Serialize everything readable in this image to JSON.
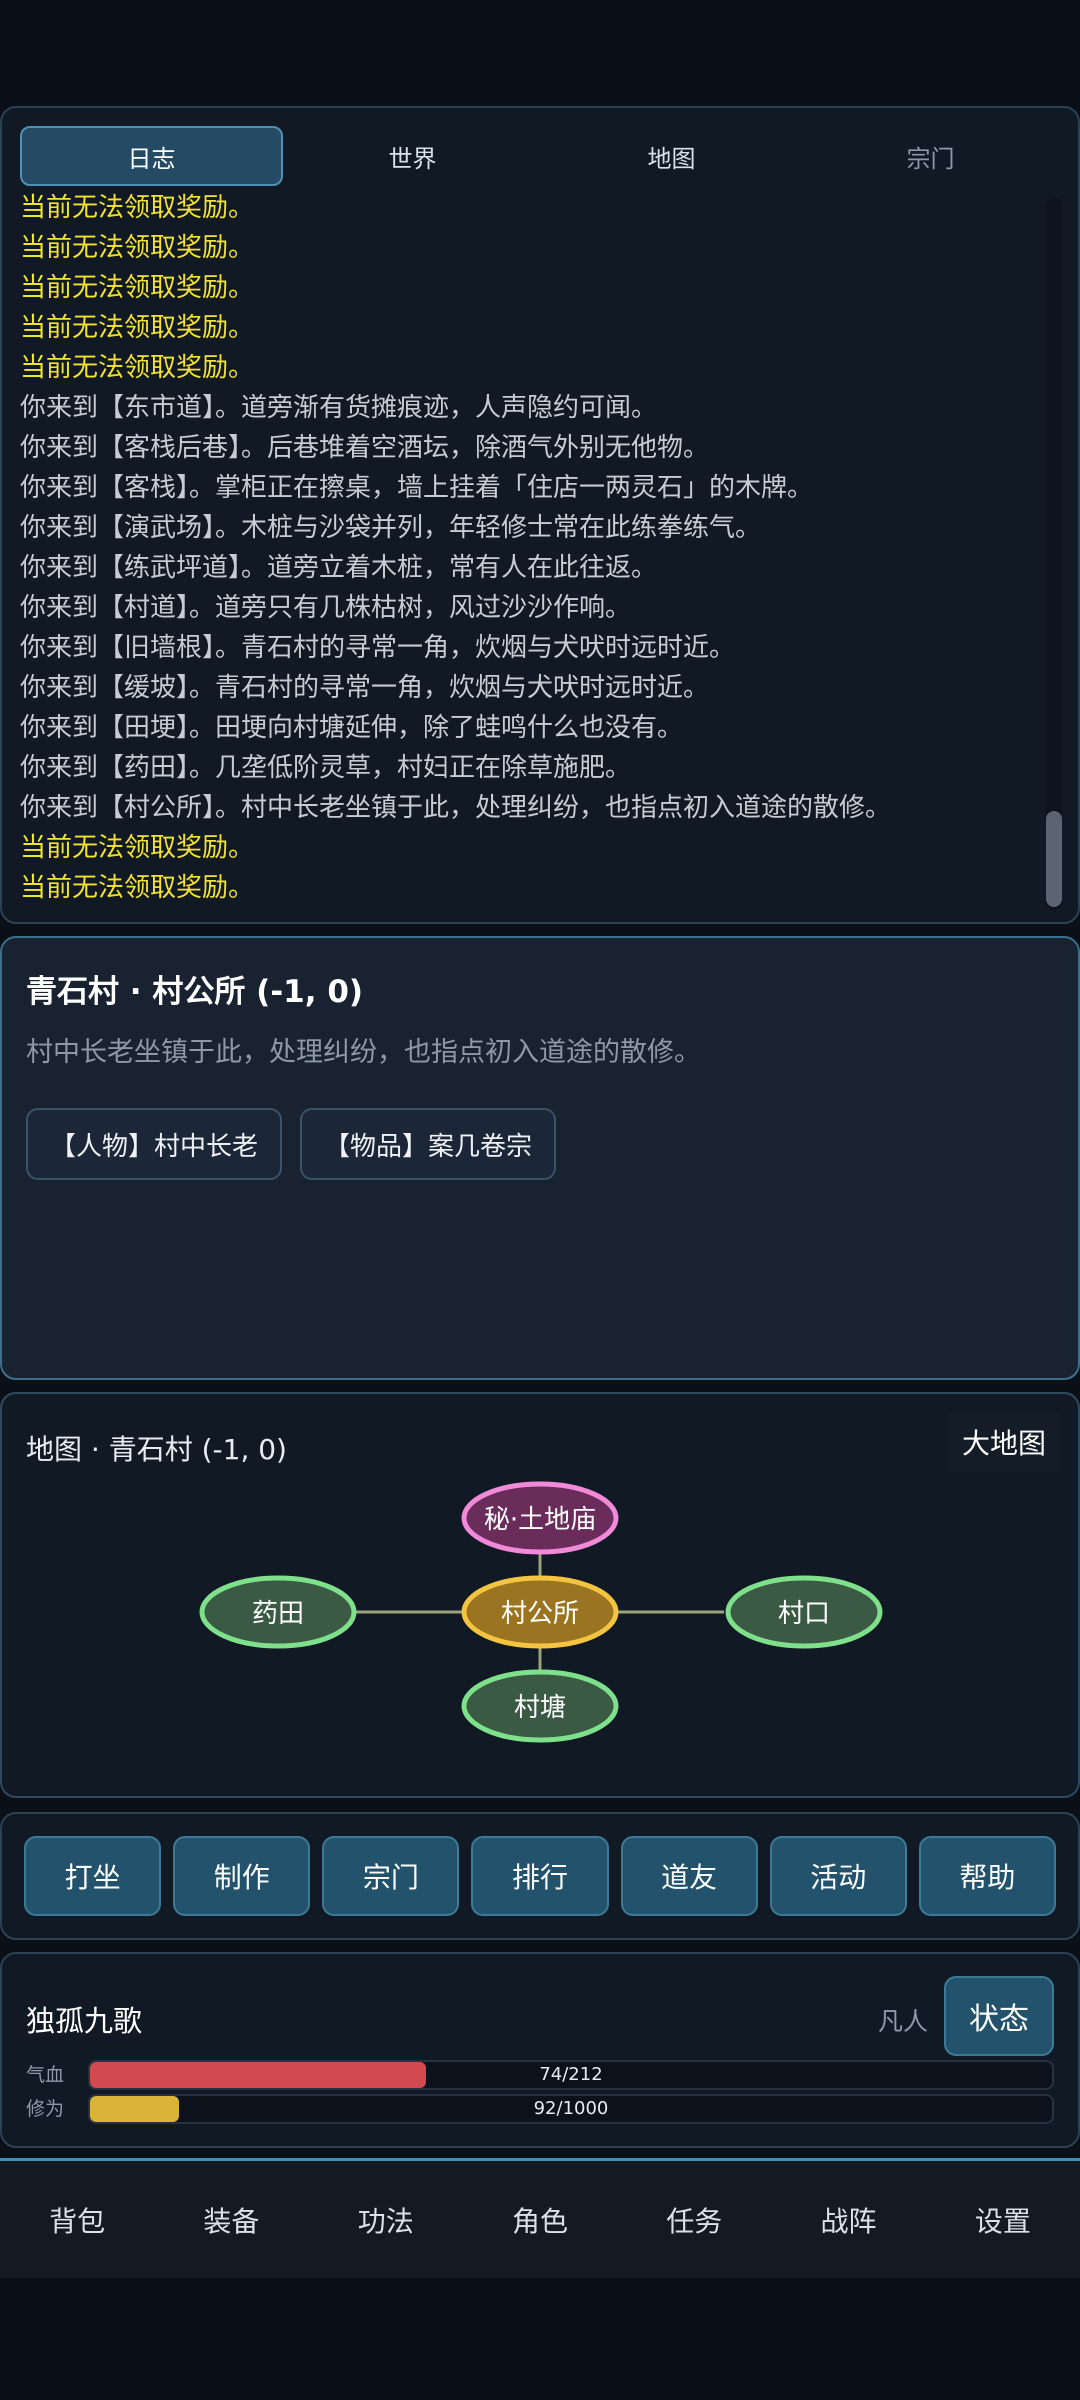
{
  "log": {
    "tabs": [
      {
        "label": "日志"
      },
      {
        "label": "世界"
      },
      {
        "label": "地图"
      },
      {
        "label": "宗门"
      }
    ],
    "lines": [
      {
        "text": "当前无法领取奖励。",
        "kind": "warn"
      },
      {
        "text": "当前无法领取奖励。",
        "kind": "warn"
      },
      {
        "text": "当前无法领取奖励。",
        "kind": "warn"
      },
      {
        "text": "当前无法领取奖励。",
        "kind": "warn"
      },
      {
        "text": "当前无法领取奖励。",
        "kind": "warn"
      },
      {
        "text": "你来到【东市道】。道旁渐有货摊痕迹，人声隐约可闻。",
        "kind": "info"
      },
      {
        "text": "你来到【客栈后巷】。后巷堆着空酒坛，除酒气外别无他物。",
        "kind": "info"
      },
      {
        "text": "你来到【客栈】。掌柜正在擦桌，墙上挂着「住店一两灵石」的木牌。",
        "kind": "info"
      },
      {
        "text": "你来到【演武场】。木桩与沙袋并列，年轻修士常在此练拳练气。",
        "kind": "info"
      },
      {
        "text": "你来到【练武坪道】。道旁立着木桩，常有人在此往返。",
        "kind": "info"
      },
      {
        "text": "你来到【村道】。道旁只有几株枯树，风过沙沙作响。",
        "kind": "info"
      },
      {
        "text": "你来到【旧墙根】。青石村的寻常一角，炊烟与犬吠时远时近。",
        "kind": "info"
      },
      {
        "text": "你来到【缓坡】。青石村的寻常一角，炊烟与犬吠时远时近。",
        "kind": "info"
      },
      {
        "text": "你来到【田埂】。田埂向村塘延伸，除了蛙鸣什么也没有。",
        "kind": "info"
      },
      {
        "text": "你来到【药田】。几垄低阶灵草，村妇正在除草施肥。",
        "kind": "info"
      },
      {
        "text": "你来到【村公所】。村中长老坐镇于此，处理纠纷，也指点初入道途的散修。",
        "kind": "info"
      },
      {
        "text": "当前无法领取奖励。",
        "kind": "warn"
      },
      {
        "text": "当前无法领取奖励。",
        "kind": "warn"
      }
    ]
  },
  "location": {
    "title": "青石村 · 村公所 (-1, 0)",
    "description": "村中长老坐镇于此，处理纠纷，也指点初入道途的散修。",
    "chips": [
      {
        "label": "【人物】村中长老"
      },
      {
        "label": "【物品】案几卷宗"
      }
    ]
  },
  "map": {
    "title": "地图 · 青石村 (-1, 0)",
    "big_map_label": "大地图",
    "nodes": [
      {
        "label": "秘·土地庙",
        "kind": "secret"
      },
      {
        "label": "药田",
        "kind": "normal"
      },
      {
        "label": "村公所",
        "kind": "current"
      },
      {
        "label": "村口",
        "kind": "normal"
      },
      {
        "label": "村塘",
        "kind": "normal"
      }
    ],
    "colors": {
      "normal_fill": "#3a5a44",
      "normal_stroke": "#7ee08a",
      "current_fill": "#9a7420",
      "current_stroke": "#f2c440",
      "secret_fill": "#6a2c5a",
      "secret_stroke": "#f08ad8"
    }
  },
  "actions": [
    {
      "label": "打坐"
    },
    {
      "label": "制作"
    },
    {
      "label": "宗门"
    },
    {
      "label": "排行"
    },
    {
      "label": "道友"
    },
    {
      "label": "活动"
    },
    {
      "label": "帮助"
    }
  ],
  "status": {
    "name": "独孤九歌",
    "realm": "凡人",
    "button_label": "状态",
    "hp": {
      "label": "气血",
      "text": "74/212",
      "current": 74,
      "max": 212,
      "color": "#d24a4f"
    },
    "exp": {
      "label": "修为",
      "text": "92/1000",
      "current": 92,
      "max": 1000,
      "color": "#d9b436"
    }
  },
  "nav": [
    {
      "label": "背包"
    },
    {
      "label": "装备"
    },
    {
      "label": "功法"
    },
    {
      "label": "角色"
    },
    {
      "label": "任务"
    },
    {
      "label": "战阵"
    },
    {
      "label": "设置"
    }
  ]
}
